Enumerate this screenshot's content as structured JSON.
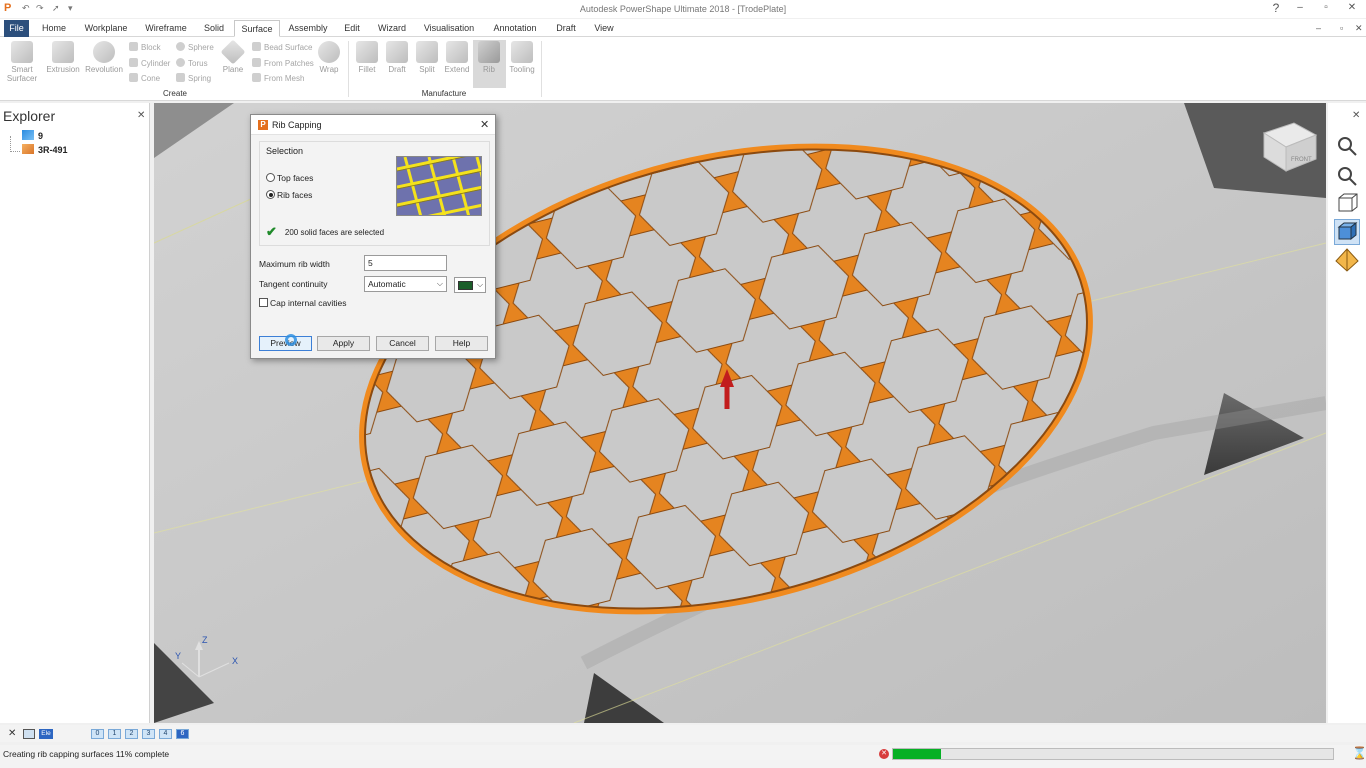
{
  "window": {
    "title": "Autodesk PowerShape Ultimate 2018 - [TrodePlate]",
    "help_icon": "question-icon"
  },
  "menu_tabs": [
    {
      "label": "File"
    },
    {
      "label": "Home"
    },
    {
      "label": "Workplane"
    },
    {
      "label": "Wireframe"
    },
    {
      "label": "Solid"
    },
    {
      "label": "Surface"
    },
    {
      "label": "Assembly"
    },
    {
      "label": "Edit"
    },
    {
      "label": "Wizard"
    },
    {
      "label": "Visualisation"
    },
    {
      "label": "Annotation"
    },
    {
      "label": "Draft"
    },
    {
      "label": "View"
    }
  ],
  "active_tab": "Surface",
  "ribbon": {
    "create": {
      "group_label": "Create",
      "large": [
        {
          "label1": "Smart",
          "label2": "Surfacer"
        },
        {
          "label1": "Extrusion",
          "label2": ""
        },
        {
          "label1": "Revolution",
          "label2": ""
        }
      ],
      "small_col1": [
        {
          "label": "Block"
        },
        {
          "label": "Cylinder"
        },
        {
          "label": "Cone"
        }
      ],
      "small_col2": [
        {
          "label": "Sphere"
        },
        {
          "label": "Torus"
        },
        {
          "label": "Spring"
        }
      ],
      "plane": {
        "label": "Plane"
      },
      "small_col3": [
        {
          "label": "Bead Surface"
        },
        {
          "label": "From Patches"
        },
        {
          "label": "From Mesh"
        }
      ],
      "wrap": {
        "label": "Wrap"
      }
    },
    "manufacture": {
      "group_label": "Manufacture",
      "items": [
        {
          "label": "Fillet"
        },
        {
          "label": "Draft"
        },
        {
          "label": "Split"
        },
        {
          "label": "Extend"
        },
        {
          "label": "Rib"
        },
        {
          "label": "Tooling"
        }
      ]
    }
  },
  "explorer": {
    "title": "Explorer",
    "items": [
      {
        "label": "9"
      },
      {
        "label": "3R-491"
      }
    ]
  },
  "dialog": {
    "title": "Rib Capping",
    "selection_label": "Selection",
    "radio_top": "Top faces",
    "radio_rib": "Rib faces",
    "selected_radio": "Rib faces",
    "status_text": "200 solid faces are selected",
    "max_rib_width_label": "Maximum rib width",
    "max_rib_width_value": "5",
    "tangent_label": "Tangent continuity",
    "tangent_value": "Automatic",
    "tangent_color": "#1b5e2a",
    "cap_internal_label": "Cap internal cavities",
    "cap_internal_checked": false,
    "buttons": {
      "preview": "Preview",
      "apply": "Apply",
      "cancel": "Cancel",
      "help": "Help"
    }
  },
  "viewport": {
    "axis_labels": {
      "z": "Z",
      "y": "Y",
      "x": "X"
    },
    "cube_label": "FRONT",
    "highlight_color": "#f08a1e",
    "surface_color": "#c4c4c4"
  },
  "bottom": {
    "levels": [
      "0",
      "1",
      "2",
      "3",
      "4",
      "6"
    ],
    "ele_label": "Ele"
  },
  "status": {
    "message": "Creating rib capping surfaces  11% complete",
    "progress_fraction": 0.11
  }
}
